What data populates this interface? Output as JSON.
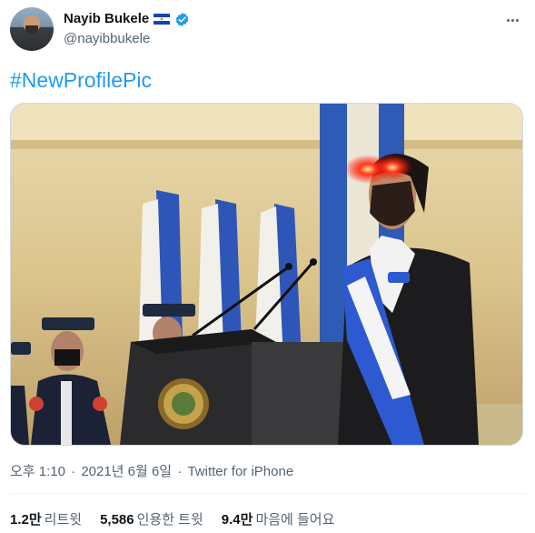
{
  "user": {
    "name": "Nayib Bukele",
    "handle": "@nayibbukele",
    "flag_icon": "el-salvador-flag-icon",
    "verified_icon": "verified-badge-icon"
  },
  "tweet": {
    "text": "#NewProfilePic"
  },
  "meta": {
    "time": "오후 1:10",
    "separator": "·",
    "date": "2021년 6월 6일",
    "source": "Twitter for iPhone"
  },
  "stats": [
    {
      "value": "1.2만",
      "label": "리트윗"
    },
    {
      "value": "5,586",
      "label": "인용한 트윗"
    },
    {
      "value": "9.4만",
      "label": "마음에 들어요"
    }
  ],
  "colors": {
    "link": "#1d9bf0",
    "secondary_text": "#536471",
    "primary_text": "#0f1419",
    "border": "#cfd9de",
    "flag_blue": "#0f47af",
    "eye_glow": "#ff2a1a"
  }
}
